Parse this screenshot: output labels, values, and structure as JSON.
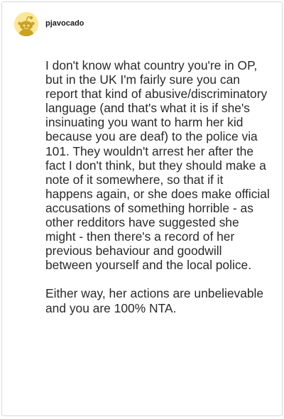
{
  "post": {
    "username": "pjavocado",
    "avatar_icon": "reddit-snoo-avatar-icon",
    "paragraphs": [
      "I don't know what country you're in OP, but in the UK I'm fairly sure you can report that kind of abusive/discriminatory language (and that's what it is if she's insinuating you want to harm her kid because you are deaf) to the police via 101. They wouldn't arrest her after the fact I don't think, but they should make a note of it somewhere, so that if it happens again, or she does make official accusations of something horrible - as other redditors have suggested she might - then there's a record of her previous behaviour and goodwill between yourself and the local police.",
      "Either way, her actions are unbelievable and you are 100% NTA."
    ]
  },
  "colors": {
    "avatar_background": "#fbe79a",
    "avatar_body": "#c9a227",
    "text": "#2a2a2a",
    "border": "#d9d9d9"
  }
}
